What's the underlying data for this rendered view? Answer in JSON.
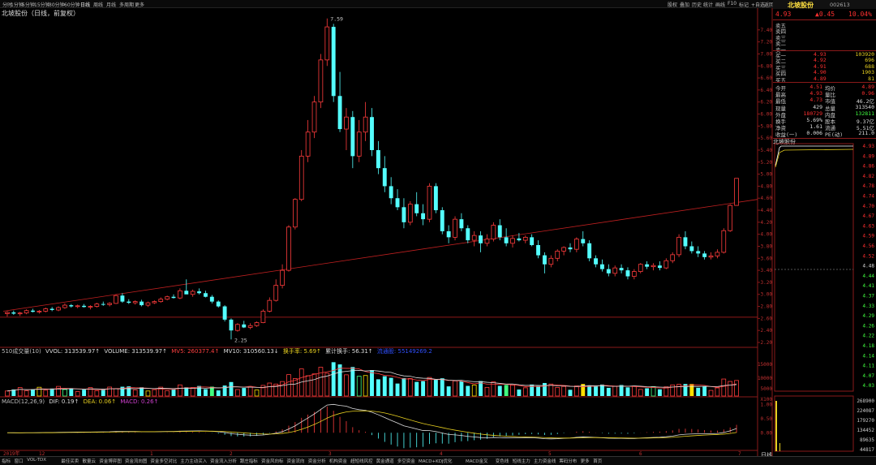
{
  "toolbar": {
    "items": [
      "分时",
      "1分钟",
      "5分钟",
      "15分钟",
      "30分钟",
      "60分钟",
      "日线",
      "周线",
      "月线",
      "多周期",
      "更多"
    ],
    "active_index": 6,
    "right_items": [
      "股权",
      "叠加",
      "历史",
      "统计",
      "画线",
      "F10",
      "标记",
      "+自选",
      "返回"
    ]
  },
  "title": "北坡股份（日线，前复权）",
  "price_axis": [
    "7.40",
    "7.20",
    "7.00",
    "6.80",
    "6.60",
    "6.40",
    "6.20",
    "6.00",
    "5.80",
    "5.60",
    "5.40",
    "5.20",
    "5.00",
    "4.80",
    "4.60",
    "4.40",
    "4.20",
    "4.00",
    "3.80",
    "3.60",
    "3.40",
    "3.20",
    "3.00",
    "2.80",
    "2.60",
    "2.40",
    "2.20"
  ],
  "annotations": {
    "high": "7.59",
    "low": "2.25"
  },
  "volume_indicator": {
    "name": "510成交量(10)",
    "vvol": "VVOL: 313539.97↑",
    "volume": "VOLUME: 313539.97↑",
    "mv5": "MV5: 260377.4↑",
    "mv10": "MV10: 310560.13↓",
    "turnover": "换手率: 5.69↑",
    "cum_turnover": "累计换手: 56.31↑",
    "extra": "流通股: 55149269.2"
  },
  "volume_axis": [
    "15000",
    "10000",
    "5000",
    "X100"
  ],
  "macd_indicator": {
    "name": "MACD(12,26,9)",
    "dif": "DIF: 0.19↑",
    "dea": "DEA: 0.06↑",
    "macd": "MACD: 0.26↑"
  },
  "macd_axis": [
    "1.00",
    "0.50",
    "0.00"
  ],
  "date_axis": [
    "2019年",
    "12",
    "1",
    "2",
    "3",
    "4",
    "5",
    "6",
    "7"
  ],
  "right_panel": {
    "stock_name": "北坡股份",
    "code": "002613",
    "price": "4.93",
    "change": "▲0.45",
    "change_pct": "10.04%",
    "sells": [
      {
        "label": "卖五",
        "price": "",
        "vol": ""
      },
      {
        "label": "卖四",
        "price": "",
        "vol": ""
      },
      {
        "label": "卖三",
        "price": "",
        "vol": ""
      },
      {
        "label": "卖二",
        "price": "",
        "vol": ""
      },
      {
        "label": "卖一",
        "price": "",
        "vol": ""
      }
    ],
    "buys": [
      {
        "label": "买一",
        "price": "4.93",
        "vol": "103920"
      },
      {
        "label": "买二",
        "price": "4.92",
        "vol": "696"
      },
      {
        "label": "买三",
        "price": "4.91",
        "vol": "688"
      },
      {
        "label": "买四",
        "price": "4.90",
        "vol": "1903"
      },
      {
        "label": "买五",
        "price": "4.89",
        "vol": "81"
      }
    ],
    "stats": [
      {
        "l1": "今开",
        "v1": "4.51",
        "l2": "均价",
        "v2": "4.89"
      },
      {
        "l1": "最高",
        "v1": "4.93",
        "l2": "量比",
        "v2": "0.96"
      },
      {
        "l1": "最低",
        "v1": "4.73",
        "l2": "市值",
        "v2": "46.2亿"
      },
      {
        "l1": "现量",
        "v1": "429",
        "l2": "总量",
        "v2": "313540"
      },
      {
        "l1": "外盘",
        "v1": "180729",
        "l2": "内盘",
        "v2": "132811"
      },
      {
        "l1": "换手",
        "v1": "5.69%",
        "l2": "股本",
        "v2": "9.37亿"
      },
      {
        "l1": "净资",
        "v1": "1.61",
        "l2": "流通",
        "v2": "5.51亿"
      },
      {
        "l1": "收益(一)",
        "v1": "0.006",
        "l2": "PE(动)",
        "v2": "211.0"
      }
    ],
    "mini_title": "北坡股份",
    "mini_axis": [
      "4.93",
      "4.89",
      "4.86",
      "4.82",
      "4.78",
      "4.74",
      "4.70",
      "4.67",
      "4.63",
      "4.59",
      "4.56",
      "4.52",
      "4.48",
      "4.44",
      "4.41",
      "4.37",
      "4.33",
      "4.29",
      "4.26",
      "4.22",
      "4.18",
      "4.14",
      "4.11",
      "4.07",
      "4.03"
    ],
    "mini_vol_axis": [
      "268900",
      "224087",
      "179270",
      "134452",
      "89635",
      "44817"
    ],
    "period_label": "日线"
  },
  "bottom_tabs": [
    "指标",
    "窗口",
    "VOL-TDX",
    "最佳买卖",
    "散量云",
    "资金博弈图",
    "资金流向图",
    "资金多空对比",
    "主力主动买入",
    "资金流入分析",
    "跟庄指标",
    "资金风向标",
    "资金流向",
    "资金分析",
    "机构资金",
    "超短线风控",
    "黄金通道",
    "多空资金",
    "MACD+KDJ优化",
    "MACD金叉",
    "变色线",
    "短线主力",
    "主力资金线",
    "筹码分布",
    "更多",
    "首页"
  ],
  "chart_data": [
    {
      "type": "candlestick",
      "title": "北坡股份（日线，前复权）",
      "ylim": [
        2.2,
        7.6
      ],
      "high_label": 7.59,
      "low_label": 2.25,
      "ohlc": [
        [
          2.68,
          2.72,
          2.63,
          2.7
        ],
        [
          2.7,
          2.73,
          2.66,
          2.68
        ],
        [
          2.68,
          2.71,
          2.64,
          2.69
        ],
        [
          2.69,
          2.75,
          2.67,
          2.73
        ],
        [
          2.73,
          2.76,
          2.7,
          2.71
        ],
        [
          2.71,
          2.74,
          2.68,
          2.72
        ],
        [
          2.72,
          2.78,
          2.7,
          2.76
        ],
        [
          2.76,
          2.79,
          2.72,
          2.74
        ],
        [
          2.74,
          2.8,
          2.72,
          2.78
        ],
        [
          2.78,
          2.85,
          2.76,
          2.82
        ],
        [
          2.82,
          2.84,
          2.78,
          2.8
        ],
        [
          2.8,
          2.83,
          2.77,
          2.81
        ],
        [
          2.81,
          2.84,
          2.78,
          2.79
        ],
        [
          2.79,
          2.82,
          2.75,
          2.8
        ],
        [
          2.8,
          2.86,
          2.78,
          2.84
        ],
        [
          2.84,
          2.88,
          2.81,
          2.83
        ],
        [
          2.83,
          2.87,
          2.8,
          2.85
        ],
        [
          2.85,
          3.0,
          2.84,
          2.98
        ],
        [
          2.98,
          3.02,
          2.86,
          2.88
        ],
        [
          2.88,
          2.92,
          2.84,
          2.86
        ],
        [
          2.86,
          2.9,
          2.83,
          2.88
        ],
        [
          2.88,
          2.91,
          2.8,
          2.82
        ],
        [
          2.82,
          2.88,
          2.79,
          2.86
        ],
        [
          2.86,
          2.9,
          2.84,
          2.88
        ],
        [
          2.88,
          2.95,
          2.86,
          2.92
        ],
        [
          2.92,
          2.98,
          2.9,
          2.96
        ],
        [
          2.96,
          3.0,
          2.93,
          2.94
        ],
        [
          2.94,
          3.1,
          2.92,
          3.06
        ],
        [
          3.06,
          3.25,
          3.02,
          3.0
        ],
        [
          3.0,
          3.08,
          2.96,
          3.05
        ],
        [
          3.05,
          3.1,
          3.0,
          3.02
        ],
        [
          3.02,
          3.06,
          2.95,
          2.96
        ],
        [
          2.96,
          2.99,
          2.85,
          2.88
        ],
        [
          2.88,
          2.9,
          2.78,
          2.8
        ],
        [
          2.8,
          2.82,
          2.55,
          2.58
        ],
        [
          2.58,
          2.6,
          2.25,
          2.4
        ],
        [
          2.4,
          2.52,
          2.38,
          2.5
        ],
        [
          2.5,
          2.56,
          2.44,
          2.45
        ],
        [
          2.45,
          2.52,
          2.42,
          2.48
        ],
        [
          2.48,
          2.55,
          2.46,
          2.53
        ],
        [
          2.53,
          2.75,
          2.52,
          2.72
        ],
        [
          2.72,
          2.95,
          2.7,
          2.9
        ],
        [
          2.9,
          3.25,
          2.88,
          3.15
        ],
        [
          3.15,
          3.5,
          3.1,
          3.4
        ],
        [
          3.4,
          4.15,
          3.38,
          4.12
        ],
        [
          4.12,
          4.6,
          4.08,
          4.58
        ],
        [
          4.58,
          5.4,
          4.55,
          5.3
        ],
        [
          5.3,
          5.9,
          5.2,
          5.7
        ],
        [
          5.7,
          6.3,
          5.6,
          6.2
        ],
        [
          6.2,
          7.0,
          6.1,
          6.9
        ],
        [
          6.9,
          7.59,
          6.8,
          7.45
        ],
        [
          7.45,
          7.5,
          6.2,
          6.3
        ],
        [
          6.3,
          6.7,
          5.7,
          5.75
        ],
        [
          5.75,
          6.1,
          5.4,
          5.95
        ],
        [
          5.95,
          6.05,
          5.1,
          5.3
        ],
        [
          5.3,
          5.9,
          5.2,
          5.7
        ],
        [
          5.7,
          6.2,
          5.55,
          5.95
        ],
        [
          5.95,
          6.1,
          5.3,
          5.4
        ],
        [
          5.4,
          5.55,
          5.0,
          5.1
        ],
        [
          5.1,
          5.3,
          4.7,
          4.8
        ],
        [
          4.8,
          4.95,
          4.5,
          4.6
        ],
        [
          4.6,
          4.75,
          4.4,
          4.45
        ],
        [
          4.45,
          4.6,
          4.1,
          4.2
        ],
        [
          4.2,
          4.55,
          4.15,
          4.5
        ],
        [
          4.5,
          4.7,
          4.3,
          4.35
        ],
        [
          4.35,
          4.5,
          4.15,
          4.25
        ],
        [
          4.25,
          4.85,
          4.2,
          4.8
        ],
        [
          4.8,
          4.85,
          4.35,
          4.4
        ],
        [
          4.4,
          4.45,
          4.0,
          4.05
        ],
        [
          4.05,
          4.15,
          3.85,
          3.95
        ],
        [
          3.95,
          4.3,
          3.9,
          4.25
        ],
        [
          4.25,
          4.35,
          4.05,
          4.1
        ],
        [
          4.1,
          4.15,
          3.85,
          3.9
        ],
        [
          3.9,
          4.05,
          3.8,
          3.98
        ],
        [
          3.98,
          4.05,
          3.7,
          3.85
        ],
        [
          3.85,
          4.0,
          3.8,
          3.92
        ],
        [
          3.92,
          4.2,
          3.88,
          4.15
        ],
        [
          4.15,
          4.25,
          3.9,
          3.95
        ],
        [
          3.95,
          4.1,
          3.8,
          3.85
        ],
        [
          3.85,
          3.98,
          3.78,
          3.93
        ],
        [
          3.93,
          4.02,
          3.88,
          3.9
        ],
        [
          3.9,
          3.98,
          3.85,
          3.95
        ],
        [
          3.95,
          4.0,
          3.8,
          3.82
        ],
        [
          3.82,
          3.9,
          3.6,
          3.65
        ],
        [
          3.65,
          3.7,
          3.35,
          3.5
        ],
        [
          3.5,
          3.65,
          3.45,
          3.6
        ],
        [
          3.6,
          3.75,
          3.55,
          3.72
        ],
        [
          3.72,
          3.8,
          3.65,
          3.78
        ],
        [
          3.78,
          3.85,
          3.7,
          3.75
        ],
        [
          3.75,
          3.95,
          3.7,
          3.92
        ],
        [
          3.92,
          4.05,
          3.8,
          3.85
        ],
        [
          3.85,
          3.9,
          3.55,
          3.6
        ],
        [
          3.6,
          3.65,
          3.45,
          3.5
        ],
        [
          3.5,
          3.58,
          3.38,
          3.42
        ],
        [
          3.42,
          3.5,
          3.3,
          3.35
        ],
        [
          3.35,
          3.48,
          3.3,
          3.44
        ],
        [
          3.44,
          3.5,
          3.35,
          3.4
        ],
        [
          3.4,
          3.45,
          3.25,
          3.3
        ],
        [
          3.3,
          3.42,
          3.25,
          3.38
        ],
        [
          3.38,
          3.52,
          3.35,
          3.5
        ],
        [
          3.5,
          3.55,
          3.42,
          3.46
        ],
        [
          3.46,
          3.52,
          3.4,
          3.48
        ],
        [
          3.48,
          3.55,
          3.4,
          3.44
        ],
        [
          3.44,
          3.6,
          3.42,
          3.56
        ],
        [
          3.56,
          3.7,
          3.52,
          3.66
        ],
        [
          3.66,
          4.0,
          3.62,
          3.95
        ],
        [
          3.95,
          4.05,
          3.75,
          3.8
        ],
        [
          3.8,
          3.88,
          3.68,
          3.72
        ],
        [
          3.72,
          3.8,
          3.62,
          3.68
        ],
        [
          3.68,
          3.72,
          3.58,
          3.62
        ],
        [
          3.62,
          3.7,
          3.58,
          3.64
        ],
        [
          3.64,
          3.75,
          3.6,
          3.7
        ],
        [
          3.7,
          4.1,
          3.68,
          4.06
        ],
        [
          4.06,
          4.5,
          4.04,
          4.48
        ],
        [
          4.48,
          4.93,
          4.51,
          4.93
        ]
      ],
      "trendline": {
        "from": [
          0,
          2.72
        ],
        "to": [
          122,
          4.58
        ]
      },
      "horizontal_level": 2.62
    },
    {
      "type": "bar",
      "title": "510成交量(10)",
      "ylim": [
        0,
        16000
      ],
      "ylabel": "X100"
    },
    {
      "type": "line",
      "title": "MACD(12,26,9)",
      "ylim": [
        -0.6,
        1.05
      ],
      "series": [
        {
          "name": "DIF"
        },
        {
          "name": "DEA"
        }
      ]
    }
  ]
}
